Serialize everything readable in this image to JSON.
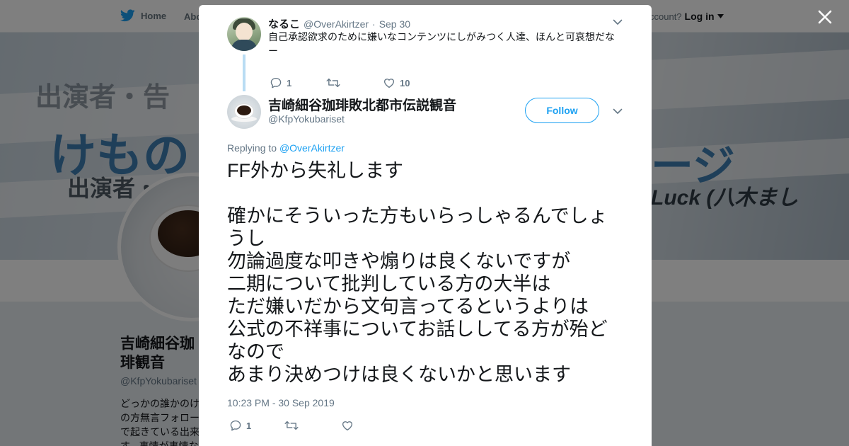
{
  "topnav": {
    "home_label": "Home",
    "about_label": "Abo",
    "account_prompt": "ccount?",
    "login_label": "Log in"
  },
  "banner": {
    "line1": "出演者・告",
    "line2": "けもの",
    "line3": "出演者・",
    "line4": "ージ",
    "line5": "Luck (八木まし"
  },
  "profile": {
    "name": "吉崎細谷珈琲観音",
    "handle": "@KfpYokubariset",
    "bio": "どっかの誰かのけの方無言フォローで起きている出来す。事情が事情な"
  },
  "modal": {
    "parent_tweet": {
      "name": "なるこ",
      "handle": "@OverAkirtzer",
      "separator": "·",
      "date": "Sep 30",
      "text": "自己承認欲求のために嫌いなコンテンツにしがみつく人達、ほんと可哀想だなー",
      "reply_count": "1",
      "retweet_count": "",
      "like_count": "10"
    },
    "tweet": {
      "name": "吉崎細谷珈琲敗北都市伝説観音",
      "handle": "@KfpYokubariset",
      "follow_label": "Follow",
      "replying_prefix": "Replying to",
      "replying_to": "@OverAkirtzer",
      "paragraphs": [
        "FF外から失礼します",
        "確かにそういった方もいらっしゃるんでしょうし\n勿論過度な叩きや煽りは良くないですが\n二期について批判している方の大半は\nただ嫌いだから文句言ってるというよりは\n公式の不祥事についてお話ししてる方が殆どなので\nあまり決めつけは良くないかと思います"
      ],
      "timestamp": "10:23 PM - 30 Sep 2019",
      "reply_count": "1",
      "retweet_count": "",
      "like_count": ""
    }
  },
  "colors": {
    "twitter_blue": "#1da1f2",
    "thread_line": "#b9dcf3",
    "secondary_text": "#657786",
    "primary_text": "#14171a"
  },
  "icons": [
    "twitter-bird-icon",
    "close-icon",
    "chevron-down-icon",
    "reply-icon",
    "retweet-icon",
    "heart-icon",
    "caret-down-icon"
  ]
}
